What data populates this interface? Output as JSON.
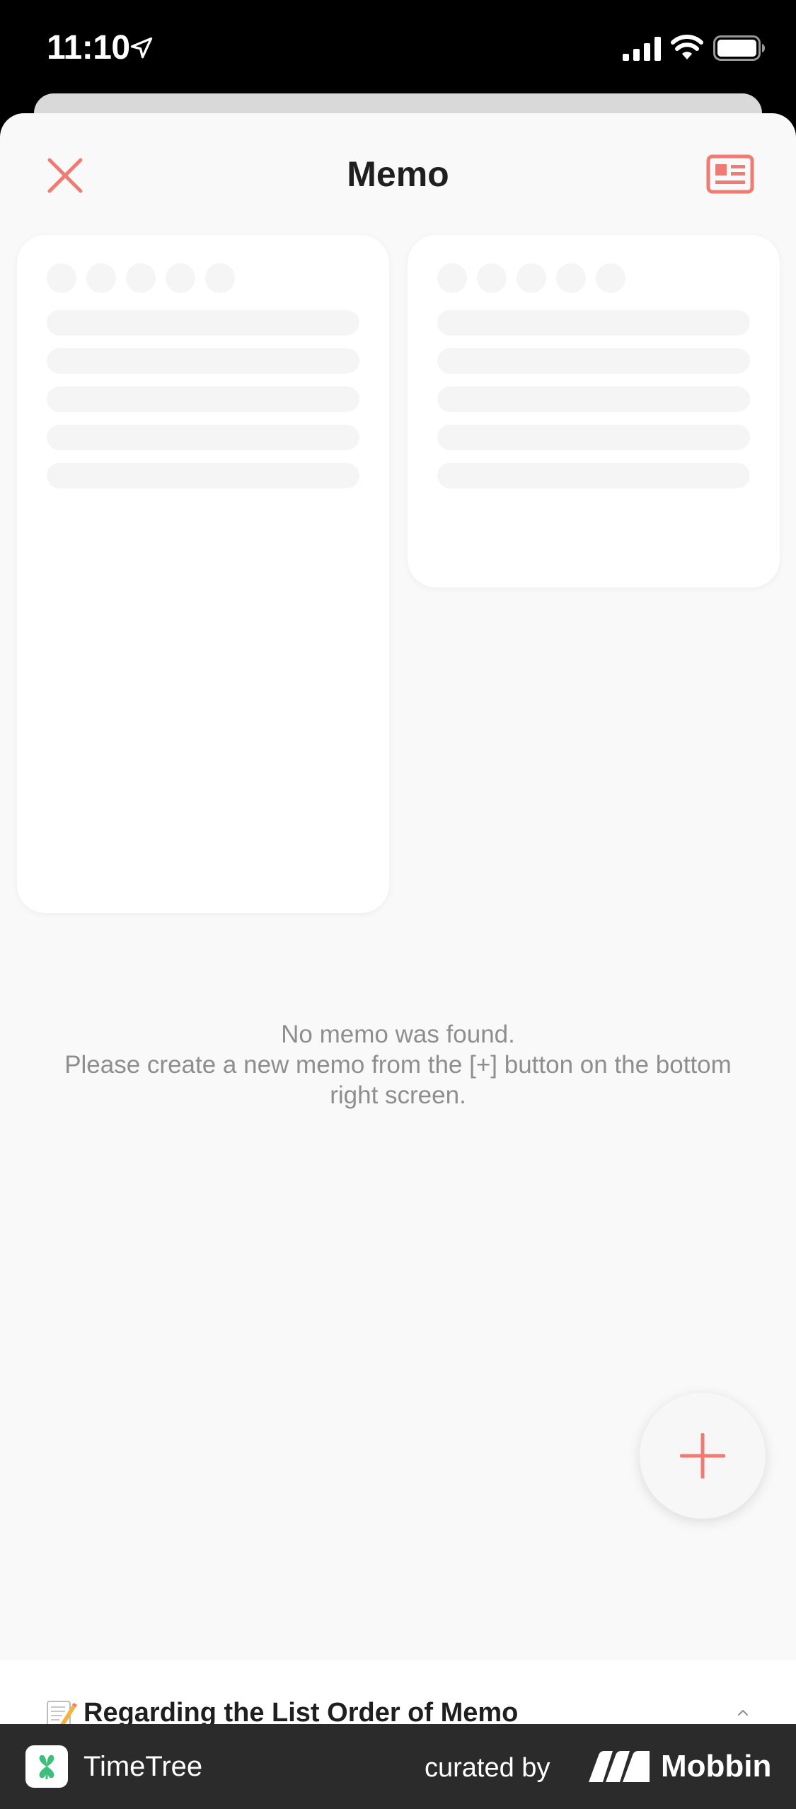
{
  "status_bar": {
    "time": "11:10",
    "icons": [
      "location-arrow-icon",
      "cellular-signal-icon",
      "wifi-icon",
      "battery-icon"
    ]
  },
  "header": {
    "title": "Memo",
    "close_icon": "close-icon",
    "layout_icon": "list-layout-icon"
  },
  "empty_state": {
    "line1": "No memo was found.",
    "line2": "Please create a new memo from the [+] button on the bottom",
    "line3": "right screen."
  },
  "fab": {
    "icon": "plus-icon"
  },
  "notice": {
    "emoji_icon": "memo-pencil-icon",
    "title": "Regarding the List Order of Memo",
    "chevron_icon": "chevron-up-icon"
  },
  "footer": {
    "app_name": "TimeTree",
    "curated_by": "curated by",
    "brand": "Mobbin"
  },
  "colors": {
    "accent": "#f07b72",
    "background": "#f9f9f9",
    "text_primary": "#1f1f1f",
    "text_secondary": "#8e8e8e",
    "footer_bg": "#2b2b2b",
    "timetree_green": "#3dbe7a"
  }
}
